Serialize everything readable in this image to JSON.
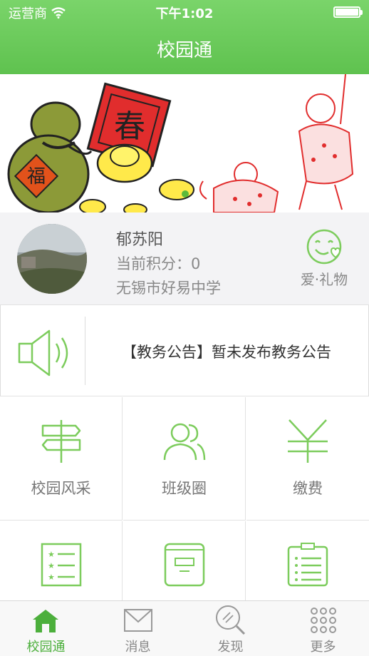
{
  "status_bar": {
    "carrier": "运营商",
    "time": "下午1:02"
  },
  "nav": {
    "title": "校园通"
  },
  "profile": {
    "name": "郁苏阳",
    "points_label": "当前积分：",
    "points_value": "0",
    "school": "无锡市好易中学",
    "gift_label": "爱·礼物"
  },
  "notice": {
    "text": "【教务公告】暂未发布教务公告"
  },
  "grid": {
    "items": [
      {
        "label": "校园风采",
        "icon": "signpost-icon"
      },
      {
        "label": "班级圈",
        "icon": "people-icon"
      },
      {
        "label": "缴费",
        "icon": "yen-icon"
      },
      {
        "label": "",
        "icon": "list-icon"
      },
      {
        "label": "",
        "icon": "book-icon"
      },
      {
        "label": "",
        "icon": "clipboard-icon"
      }
    ]
  },
  "tabbar": {
    "items": [
      {
        "label": "校园通",
        "icon": "home-icon",
        "active": true
      },
      {
        "label": "消息",
        "icon": "envelope-icon"
      },
      {
        "label": "发现",
        "icon": "discover-icon"
      },
      {
        "label": "更多",
        "icon": "more-icon"
      }
    ]
  },
  "colors": {
    "accent": "#5fc24f",
    "icon_green": "#7ccc5c"
  }
}
